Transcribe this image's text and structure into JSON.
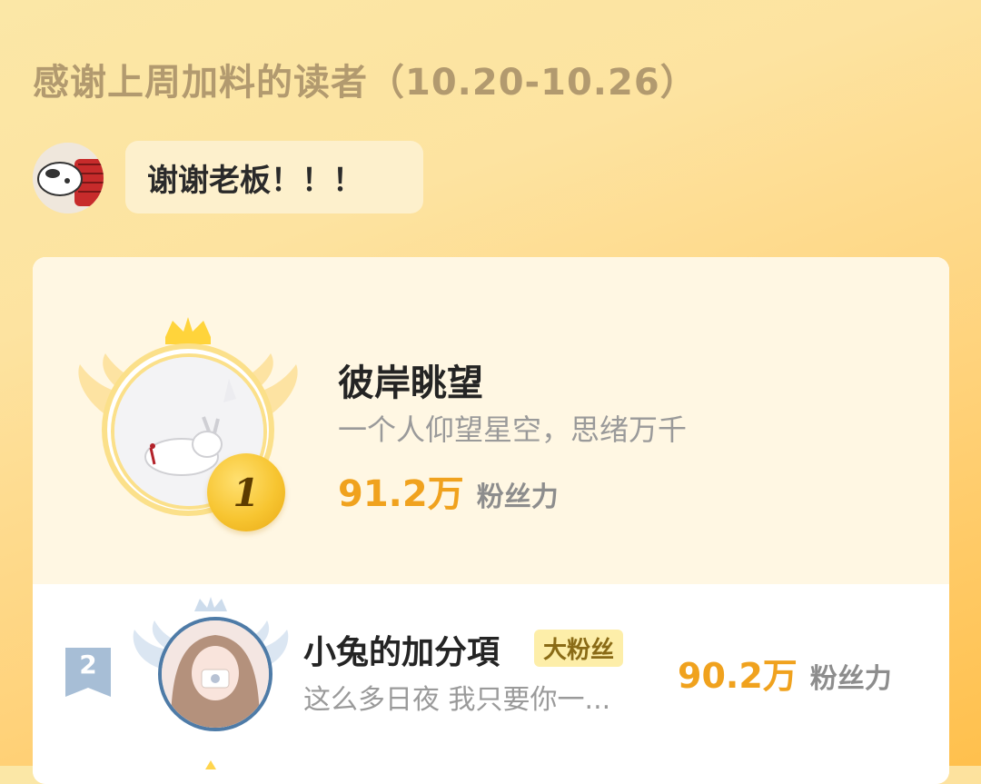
{
  "header": {
    "title": "感谢上周加料的读者（10.20-10.26）"
  },
  "host": {
    "message": "谢谢老板！！！"
  },
  "ranking": [
    {
      "rank": "1",
      "name": "彼岸眺望",
      "bio": "一个人仰望星空，思绪万千",
      "score": "91.2万",
      "score_label": "粉丝力"
    },
    {
      "rank": "2",
      "name": "小兔的加分項",
      "tag": "大粉丝",
      "bio": "这么多日夜 我只要你一...",
      "score": "90.2万",
      "score_label": "粉丝力"
    }
  ],
  "colors": {
    "gold": "#f0a21e",
    "rank2_blue": "#4e7ba7"
  },
  "icons": {
    "crown": "crown-icon",
    "wings": "wings-icon",
    "medal": "medal-icon",
    "rank_ribbon": "ribbon-badge-icon"
  }
}
